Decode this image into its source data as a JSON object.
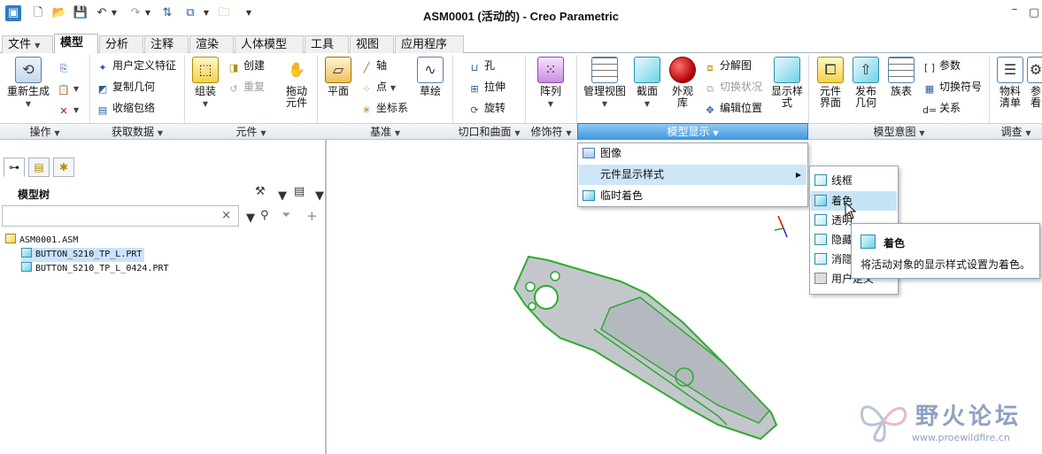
{
  "window": {
    "title": "ASM0001 (活动的) - Creo Parametric"
  },
  "tabs": [
    "文件",
    "模型",
    "分析",
    "注释",
    "渲染",
    "人体模型",
    "工具",
    "视图",
    "应用程序"
  ],
  "ribbon": {
    "regenerate": "重新生成",
    "user_defined_feature": "用户定义特征",
    "copy_geometry": "复制几何",
    "shrinkwrap": "收缩包络",
    "assemble": "组装",
    "create": "创建",
    "repeat": "重复",
    "drag_components": "拖动\n元件",
    "plane": "平面",
    "axis": "轴",
    "point": "点",
    "csys": "坐标系",
    "sketch": "草绘",
    "hole": "孔",
    "extrude": "拉伸",
    "revolve": "旋转",
    "pattern": "阵列",
    "manage_views": "管理视图",
    "section": "截面",
    "appearance": "外观\n库",
    "display_style": "显示样\n式",
    "exploded_view": "分解图",
    "toggle_status": "切换状况",
    "edit_position": "编辑位置",
    "component_interface": "元件\n界面",
    "publish_geometry": "发布\n几何",
    "family_table": "族表",
    "parameters": "参数",
    "switch_symbols": "切换符号",
    "relations": "关系",
    "bom": "物料\n清单",
    "reference_viewer": "参\n看"
  },
  "groups": [
    "操作",
    "获取数据",
    "元件",
    "基准",
    "切口和曲面",
    "修饰符",
    "模型显示",
    "模型意图",
    "调查"
  ],
  "left_panel": {
    "title": "模型树",
    "search_clear": "×",
    "tree": [
      {
        "label": "ASM0001.ASM",
        "type": "asm"
      },
      {
        "label": "BUTTON_S210_TP_L.PRT",
        "type": "prt",
        "selected": true
      },
      {
        "label": "BUTTON_S210_TP_L_0424.PRT",
        "type": "prt"
      }
    ]
  },
  "menu": {
    "items": [
      "图像",
      "元件显示样式",
      "临时着色"
    ],
    "submenu": [
      "线框",
      "着色",
      "透明",
      "隐藏",
      "消隐",
      "用户定义"
    ]
  },
  "tooltip": {
    "title": "着色",
    "desc": "将活动对象的显示样式设置为着色。"
  },
  "watermark": {
    "title": "野火论坛",
    "url": "www.proewildfire.cn"
  }
}
